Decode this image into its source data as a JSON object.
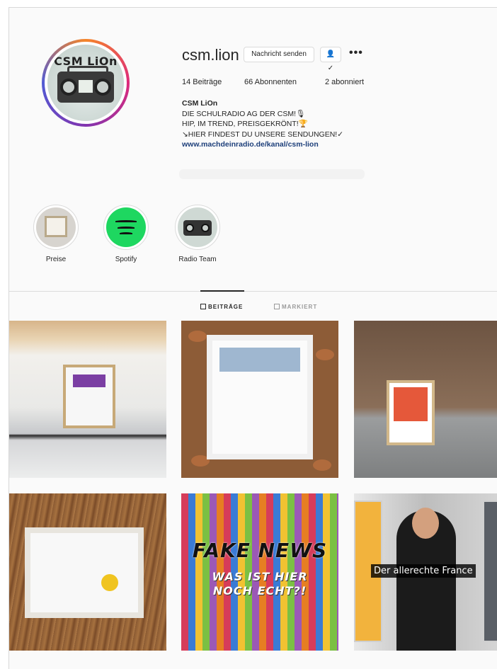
{
  "profile": {
    "avatar_text": "CSM LiOn",
    "username": "csm.lion",
    "message_button": "Nachricht senden",
    "follow_icon": "person-check-icon",
    "more_label": "•••",
    "stats": {
      "posts": "14 Beiträge",
      "followers": "66 Abonnenten",
      "following": "2 abonniert"
    },
    "bio": {
      "name": "CSM LiOn",
      "line1": "DIE SCHULRADIO AG DER CSM!🎙",
      "line2": "HIP, IM TREND, PREISGEKRÖNT!🏆",
      "line3": "↘HIER FINDEST DU UNSERE SENDUNGEN!✓",
      "link": "www.machdeinradio.de/kanal/csm-lion"
    }
  },
  "highlights": [
    {
      "label": "Preise"
    },
    {
      "label": "Spotify"
    },
    {
      "label": "Radio Team"
    }
  ],
  "tabs": {
    "posts": "BEITRÄGE",
    "tagged": "MARKIERT"
  },
  "posts": {
    "tile5_headline": "FAKE NEWS",
    "tile5_sub1": "WAS IST HIER",
    "tile5_sub2": "NOCH ECHT?!",
    "tile6_caption": "Der allerechte France"
  },
  "colors": {
    "text": "#262626",
    "link": "#1d3f7a",
    "border": "#dbdbdb",
    "spotify": "#1ed760"
  }
}
